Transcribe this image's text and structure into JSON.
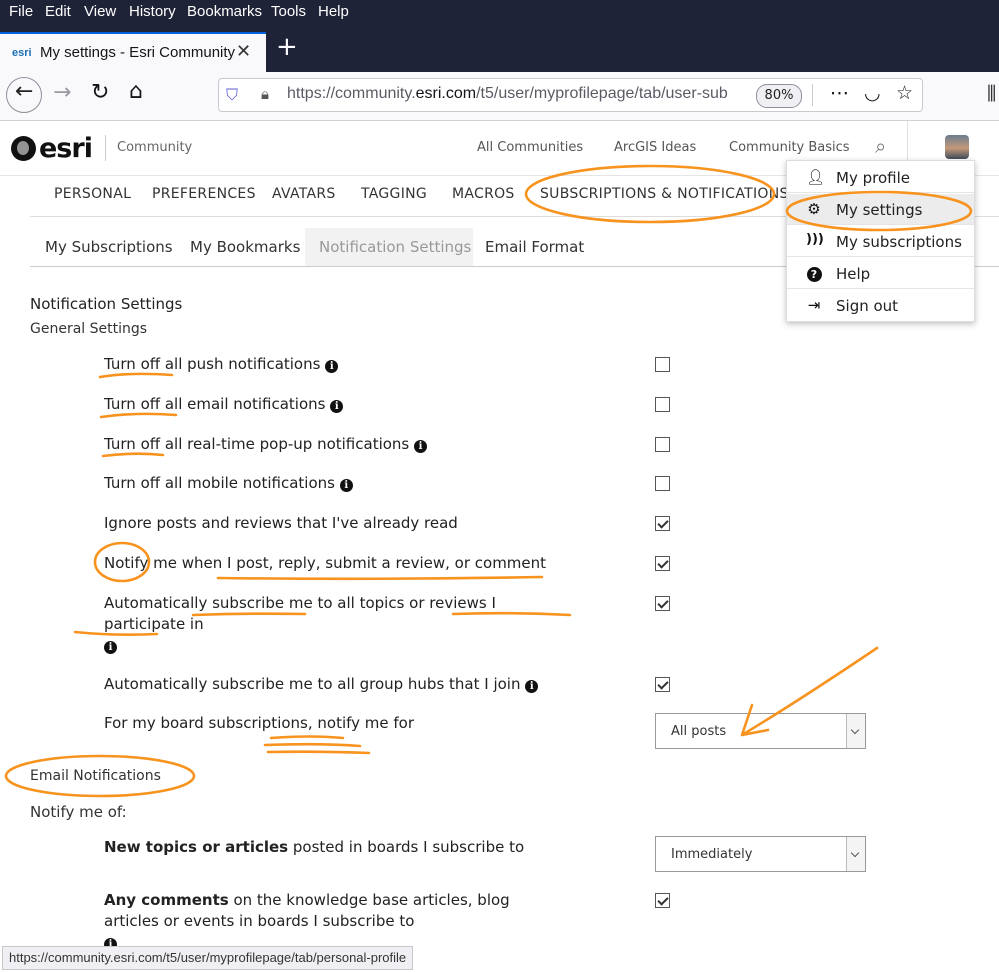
{
  "browser": {
    "menu": [
      "File",
      "Edit",
      "View",
      "History",
      "Bookmarks",
      "Tools",
      "Help"
    ],
    "tab_favicon": "esri",
    "tab_title": "My settings - Esri Community",
    "url_host_prefix": "https://community.",
    "url_host": "esri.com",
    "url_path": "/t5/user/myprofilepage/tab/user-sub",
    "zoom": "80%",
    "status_url": "https://community.esri.com/t5/user/myprofilepage/tab/personal-profile"
  },
  "header": {
    "logo": "esri",
    "community": "Community",
    "links": [
      "All Communities",
      "ArcGIS Ideas",
      "Community Basics"
    ]
  },
  "main_tabs": [
    "PERSONAL",
    "PREFERENCES",
    "AVATARS",
    "TAGGING",
    "MACROS",
    "SUBSCRIPTIONS & NOTIFICATIONS"
  ],
  "sub_tabs": [
    "My Subscriptions",
    "My Bookmarks",
    "Notification Settings",
    "Email Format"
  ],
  "notification": {
    "title": "Notification Settings",
    "general": "General Settings",
    "rows": [
      {
        "label": "Turn off all push notifications",
        "info": true,
        "checked": false
      },
      {
        "label": "Turn off all email notifications",
        "info": true,
        "checked": false
      },
      {
        "label": "Turn off all real-time pop-up notifications",
        "info": true,
        "checked": false
      },
      {
        "label": "Turn off all mobile notifications",
        "info": true,
        "checked": false
      },
      {
        "label": "Ignore posts and reviews that I've already read",
        "info": false,
        "checked": true
      },
      {
        "label": "Notify me when I post, reply, submit a review, or comment",
        "info": false,
        "checked": true
      },
      {
        "label": "Automatically subscribe me to all topics or reviews I participate in",
        "info": true,
        "checked": true
      },
      {
        "label": "Automatically subscribe me to all group hubs that I join",
        "info": true,
        "checked": true
      }
    ],
    "board_label": "For my board subscriptions, notify me for",
    "board_value": "All posts",
    "email_title": "Email Notifications",
    "notify_of": "Notify me of:",
    "new_topics_bold": "New topics or articles",
    "new_topics_rest": " posted in boards I subscribe to",
    "new_topics_value": "Immediately",
    "comments_bold": "Any comments",
    "comments_rest": " on the knowledge base articles, blog articles or events in boards I subscribe to",
    "comments_checked": true
  },
  "user_menu": [
    {
      "label": "My profile",
      "icon": "user-icon"
    },
    {
      "label": "My settings",
      "icon": "gear-icon"
    },
    {
      "label": "My subscriptions",
      "icon": "rss-icon"
    },
    {
      "label": "Help",
      "icon": "question-icon"
    },
    {
      "label": "Sign out",
      "icon": "sign-out-icon"
    }
  ],
  "annotation_color": "#f7931e"
}
